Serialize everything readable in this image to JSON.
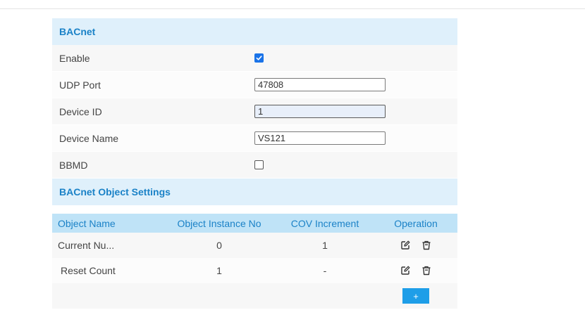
{
  "bacnet": {
    "title": "BACnet",
    "enable_label": "Enable",
    "enable_checked": true,
    "udp_port_label": "UDP Port",
    "udp_port_value": "47808",
    "device_id_label": "Device ID",
    "device_id_value": "1",
    "device_name_label": "Device Name",
    "device_name_value": "VS121",
    "bbmd_label": "BBMD",
    "bbmd_checked": false
  },
  "object_settings": {
    "title": "BACnet Object Settings",
    "columns": [
      "Object Name",
      "Object Instance No",
      "COV Increment",
      "Operation"
    ],
    "rows": [
      {
        "name": "Current Nu...",
        "instance": "0",
        "cov": "1"
      },
      {
        "name": "Reset Count",
        "instance": "1",
        "cov": "-"
      }
    ],
    "add_label": "+"
  },
  "colors": {
    "accent": "#1b82c7",
    "header_bg": "#dff0fb",
    "table_header_bg": "#bfe3f7",
    "checkbox": "#1a73e8",
    "add_button": "#1e9ee8"
  },
  "icons": [
    "check-icon",
    "edit-icon",
    "trash-icon"
  ]
}
